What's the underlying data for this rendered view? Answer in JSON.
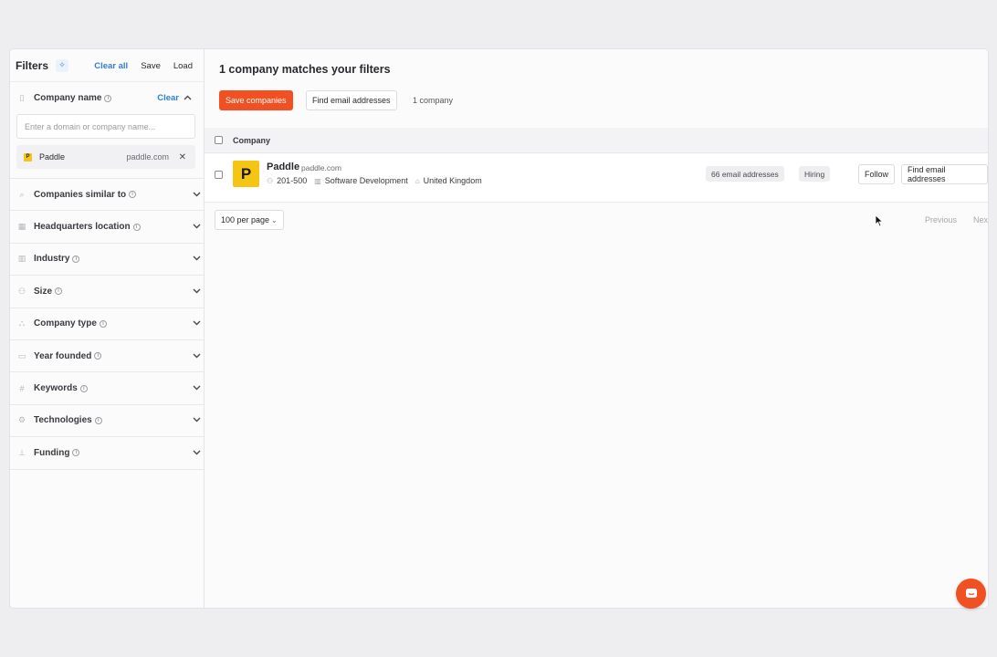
{
  "sidebar": {
    "title": "Filters",
    "clear_all": "Clear all",
    "save": "Save",
    "load": "Load",
    "company_name": {
      "label": "Company name",
      "clear": "Clear",
      "placeholder": "Enter a domain or company name...",
      "chip": {
        "logo_letter": "P",
        "name": "Paddle",
        "domain": "paddle.com"
      }
    },
    "filters": [
      {
        "label": "Companies similar to",
        "icon": "search-icon"
      },
      {
        "label": "Headquarters location",
        "icon": "building-icon"
      },
      {
        "label": "Industry",
        "icon": "industry-icon"
      },
      {
        "label": "Size",
        "icon": "people-icon"
      },
      {
        "label": "Company type",
        "icon": "org-icon"
      },
      {
        "label": "Year founded",
        "icon": "calendar-icon"
      },
      {
        "label": "Keywords",
        "icon": "hash-icon"
      },
      {
        "label": "Technologies",
        "icon": "gear-icon"
      },
      {
        "label": "Funding",
        "icon": "funding-icon"
      }
    ]
  },
  "main": {
    "title": "1 company matches your filters",
    "save_companies": "Save companies",
    "find_emails": "Find email addresses",
    "count": "1 company",
    "table": {
      "header": "Company",
      "rows": [
        {
          "logo_letter": "P",
          "name": "Paddle",
          "domain": "paddle.com",
          "size": "201-500",
          "industry": "Software Development",
          "location": "United Kingdom",
          "emails_badge": "66 email addresses",
          "hiring_badge": "Hiring",
          "follow": "Follow",
          "find_emails": "Find email addresses"
        }
      ]
    },
    "per_page": "100 per page",
    "previous": "Previous",
    "next": "Next"
  },
  "colors": {
    "accent": "#f05022",
    "link": "#2f7ed8",
    "logo_yellow": "#f5c513"
  }
}
